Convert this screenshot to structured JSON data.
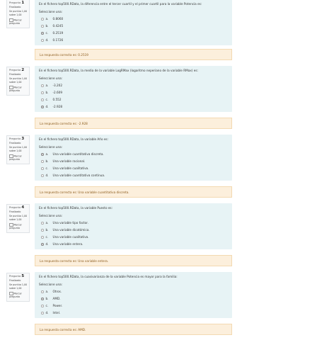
{
  "questions": [
    {
      "label": "Pregunta",
      "number": "1",
      "state": "Finalizado",
      "grade": "Se puntúa 1,00 sobre 1,00",
      "flag": "Marcar pregunta",
      "text": "En el fichero top500.RData, la diferencia entre el tercer cuartil y el primer cuartil para la variable Potencia es:",
      "prompt": "Seleccione una:",
      "answers": [
        {
          "letter": "a.",
          "text": "0.8060"
        },
        {
          "letter": "b.",
          "text": "0.4245"
        },
        {
          "letter": "c.",
          "text": "0.2519"
        },
        {
          "letter": "d.",
          "text": "0.1726"
        }
      ],
      "feedback": "La respuesta correcta es: 0.2519"
    },
    {
      "label": "Pregunta",
      "number": "2",
      "state": "Finalizado",
      "grade": "Se puntúa 1,00 sobre 1,00",
      "flag": "Marcar pregunta",
      "text": "En el fichero top500.RData, la media de la variable LogRMax (logaritmo neperiano de la variable RMax) es:",
      "prompt": "Seleccione una:",
      "answers": [
        {
          "letter": "a.",
          "text": "-3.202"
        },
        {
          "letter": "b.",
          "text": "-2.609"
        },
        {
          "letter": "c.",
          "text": "0.552"
        },
        {
          "letter": "d.",
          "text": "-2.928"
        }
      ],
      "feedback": "La respuesta correcta es: -2.928"
    },
    {
      "label": "Pregunta",
      "number": "3",
      "state": "Finalizado",
      "grade": "Se puntúa 1,00 sobre 1,00",
      "flag": "Marcar pregunta",
      "text": "En el fichero top500.RData, la variable Año es:",
      "prompt": "Seleccione una:",
      "answers": [
        {
          "letter": "a.",
          "text": "Una variable cuantitativa discreta."
        },
        {
          "letter": "b.",
          "text": "Una variable racional."
        },
        {
          "letter": "c.",
          "text": "Una variable cualitativa."
        },
        {
          "letter": "d.",
          "text": "Una variable cuantitativa continua."
        }
      ],
      "feedback": "La respuesta correcta es: Una variable cuantitativa discreta."
    },
    {
      "label": "Pregunta",
      "number": "4",
      "state": "Finalizado",
      "grade": "Se puntúa 1,00 sobre 1,00",
      "flag": "Marcar pregunta",
      "text": "En el fichero top500.RData, la variable Puesto es:",
      "prompt": "Seleccione una:",
      "answers": [
        {
          "letter": "a.",
          "text": "Una variable tipo factor."
        },
        {
          "letter": "b.",
          "text": "Una variable dicotómica."
        },
        {
          "letter": "c.",
          "text": "Una variable cualitativa."
        },
        {
          "letter": "d.",
          "text": "Una variable entera."
        }
      ],
      "feedback": "La respuesta correcta es: Una variable entera."
    },
    {
      "label": "Pregunta",
      "number": "5",
      "state": "Finalizado",
      "grade": "Se puntúa 1,00 sobre 1,00",
      "flag": "Marcar pregunta",
      "text": "En el fichero top500.RData, la cuasivarianza de la variable Potencia es mayor para la familia:",
      "prompt": "Seleccione una:",
      "answers": [
        {
          "letter": "a.",
          "text": "Otros."
        },
        {
          "letter": "b.",
          "text": "AMD."
        },
        {
          "letter": "c.",
          "text": "Power."
        },
        {
          "letter": "d.",
          "text": "Intel."
        }
      ],
      "feedback": "La respuesta correcta es: AMD."
    }
  ]
}
